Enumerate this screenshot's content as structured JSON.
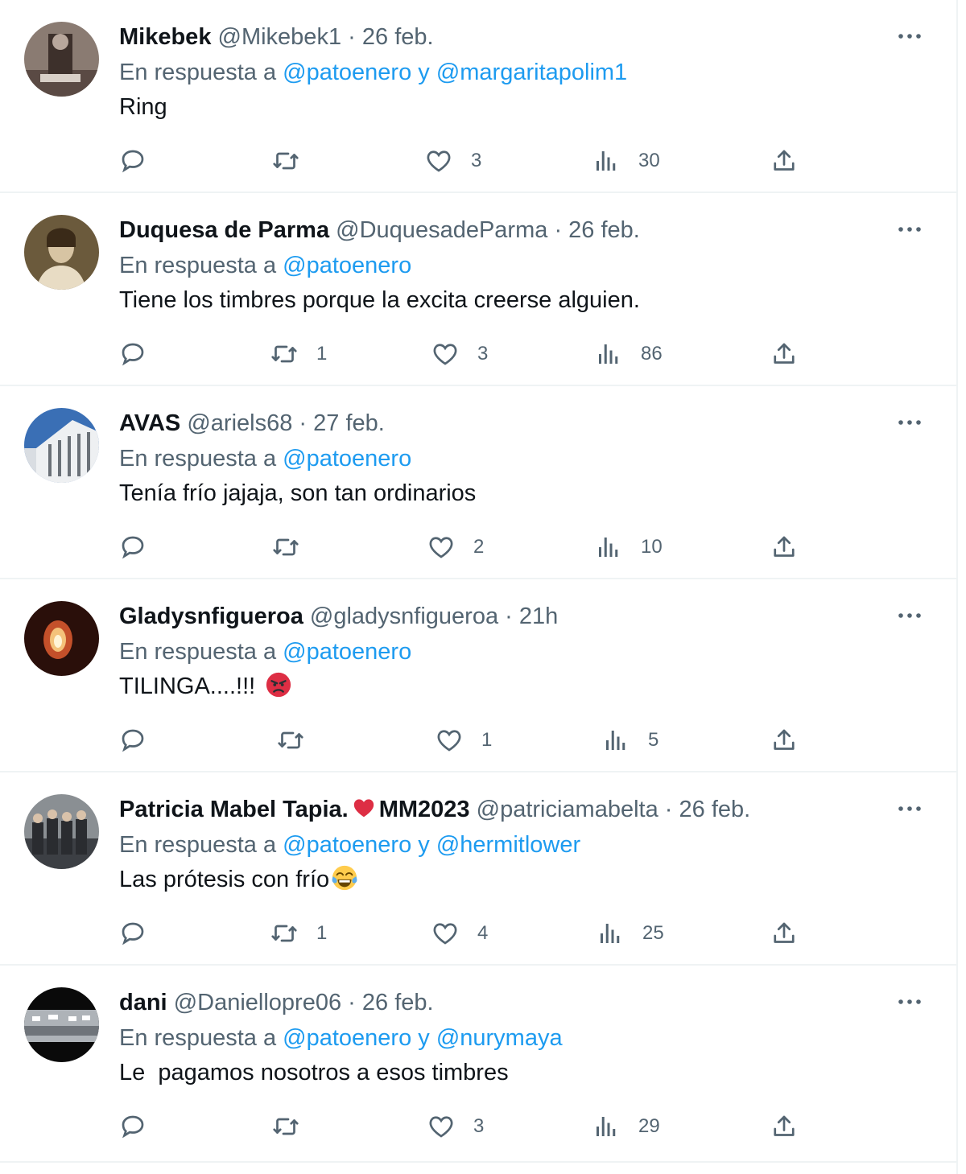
{
  "reply_prefix": "En respuesta a",
  "and_word": "y",
  "separator": "·",
  "tweets": [
    {
      "name": "Mikebek",
      "handle": "@Mikebek1",
      "time": "26 feb.",
      "mentions": [
        "@patoenero",
        "@margaritapolim1"
      ],
      "text": "Ring",
      "replies": "",
      "retweets": "",
      "likes": "3",
      "views": "30"
    },
    {
      "name": "Duquesa de Parma",
      "handle": "@DuquesadeParma",
      "time": "26 feb.",
      "mentions": [
        "@patoenero"
      ],
      "text": "Tiene los timbres porque la excita creerse alguien.",
      "replies": "",
      "retweets": "1",
      "likes": "3",
      "views": "86"
    },
    {
      "name": "AVAS",
      "handle": "@ariels68",
      "time": "27 feb.",
      "mentions": [
        "@patoenero"
      ],
      "text": "Tenía frío jajaja, son tan ordinarios",
      "replies": "",
      "retweets": "",
      "likes": "2",
      "views": "10"
    },
    {
      "name": "Gladysnfigueroa",
      "handle": "@gladysnfigueroa",
      "time": "21h",
      "mentions": [
        "@patoenero"
      ],
      "text": "TILINGA....!!!",
      "emoji": "angry-face",
      "replies": "",
      "retweets": "",
      "likes": "1",
      "views": "5"
    },
    {
      "name_part1": "Patricia Mabel Tapia.",
      "name_part2": "MM2023",
      "handle": "@patriciamabelta",
      "time": "26 feb.",
      "mentions": [
        "@patoenero",
        "@hermitlower"
      ],
      "text": "Las prótesis con frío",
      "emoji": "tears-of-joy",
      "replies": "",
      "retweets": "1",
      "likes": "4",
      "views": "25"
    },
    {
      "name": "dani",
      "handle": "@Daniellopre06",
      "time": "26 feb.",
      "mentions": [
        "@patoenero",
        "@nurymaya"
      ],
      "text": "Le  pagamos nosotros a esos timbres",
      "replies": "",
      "retweets": "",
      "likes": "3",
      "views": "29"
    }
  ],
  "colors": {
    "link": "#1d9bf0",
    "secondary_text": "#536471",
    "primary_text": "#0f1419",
    "divider": "#eff3f4"
  },
  "icons": [
    "reply-icon",
    "retweet-icon",
    "like-icon",
    "views-icon",
    "share-icon",
    "more-icon"
  ]
}
